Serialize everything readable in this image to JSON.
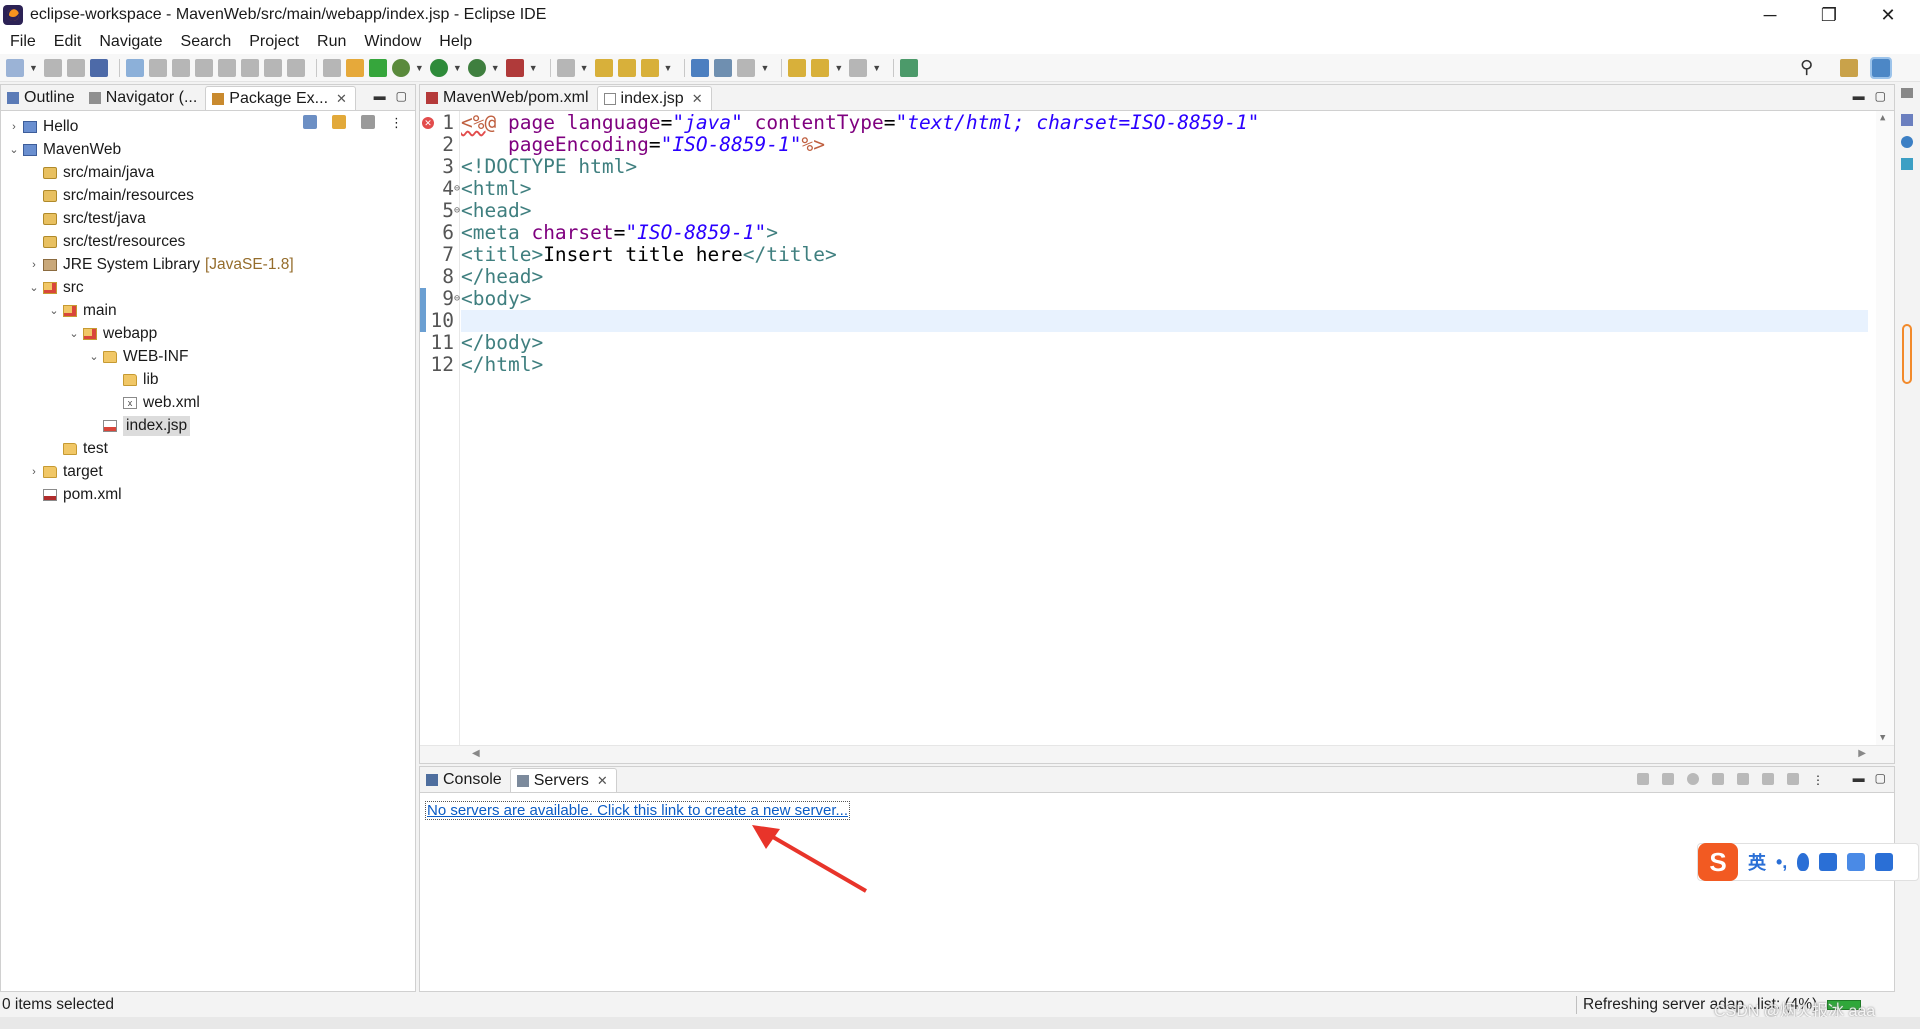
{
  "window": {
    "title": "eclipse-workspace - MavenWeb/src/main/webapp/index.jsp - Eclipse IDE",
    "minimize_glyph": "─",
    "maximize_glyph": "❐",
    "close_glyph": "✕"
  },
  "menu": [
    "File",
    "Edit",
    "Navigate",
    "Search",
    "Project",
    "Run",
    "Window",
    "Help"
  ],
  "toolbar": {
    "icons": [
      "new-icon",
      "save-icon",
      "save-all-icon",
      "terminal-icon",
      "skip-breakpoints-icon",
      "resume-icon",
      "suspend-icon",
      "terminate-icon",
      "disconnect-icon",
      "step-into-icon",
      "step-over-icon",
      "step-return-icon",
      "drop-to-frame-icon",
      "use-step-filters-icon",
      "spring-icon",
      "debug-icon",
      "run-icon",
      "coverage-icon",
      "external-tools-icon",
      "stop-server-icon",
      "open-type-icon",
      "open-task-icon",
      "search-toolbar-icon",
      "globe-icon",
      "annotation-icon",
      "next-annotation-icon",
      "last-edit-icon",
      "back-icon",
      "forward-icon",
      "pin-editor-icon"
    ],
    "search_glyph": "⚲"
  },
  "left_pane": {
    "tabs": [
      {
        "label": "Outline",
        "icon": "outline-icon"
      },
      {
        "label": "Navigator (...",
        "icon": "navigator-icon"
      },
      {
        "label": "Package Ex...",
        "icon": "package-explorer-icon",
        "active": true
      }
    ],
    "tree": [
      {
        "label": "Hello",
        "icon": "proj",
        "chev": "›",
        "depth": 0
      },
      {
        "label": "MavenWeb",
        "icon": "proj",
        "chev": "⌄",
        "depth": 0
      },
      {
        "label": "src/main/java",
        "icon": "pkg",
        "chev": "",
        "depth": 1
      },
      {
        "label": "src/main/resources",
        "icon": "pkg",
        "chev": "",
        "depth": 1
      },
      {
        "label": "src/test/java",
        "icon": "pkg",
        "chev": "",
        "depth": 1
      },
      {
        "label": "src/test/resources",
        "icon": "pkg",
        "chev": "",
        "depth": 1
      },
      {
        "label": "JRE System Library",
        "tag": "[JavaSE-1.8]",
        "icon": "lib",
        "chev": "›",
        "depth": 1
      },
      {
        "label": "src",
        "icon": "folder-web",
        "chev": "⌄",
        "depth": 1
      },
      {
        "label": "main",
        "icon": "folder-web",
        "chev": "⌄",
        "depth": 2
      },
      {
        "label": "webapp",
        "icon": "folder-web",
        "chev": "⌄",
        "depth": 3
      },
      {
        "label": "WEB-INF",
        "icon": "folder",
        "chev": "⌄",
        "depth": 4
      },
      {
        "label": "lib",
        "icon": "folder",
        "chev": "",
        "depth": 5
      },
      {
        "label": "web.xml",
        "icon": "xml",
        "chev": "",
        "depth": 5
      },
      {
        "label": "index.jsp",
        "icon": "jsp",
        "chev": "",
        "depth": 4,
        "selected": true
      },
      {
        "label": "test",
        "icon": "folder",
        "chev": "",
        "depth": 2
      },
      {
        "label": "target",
        "icon": "folder",
        "chev": "›",
        "depth": 1
      },
      {
        "label": "pom.xml",
        "icon": "pom",
        "chev": "",
        "depth": 1
      }
    ]
  },
  "editor": {
    "tabs": [
      {
        "label": "MavenWeb/pom.xml",
        "icon": "maven-file-icon"
      },
      {
        "label": "index.jsp",
        "icon": "jsp-file-icon",
        "active": true
      }
    ],
    "lines": [
      {
        "n": "1",
        "fold": "",
        "segments": [
          [
            "jsp",
            "<%@"
          ],
          [
            "t",
            " "
          ],
          [
            "attr",
            "page"
          ],
          [
            "t",
            " "
          ],
          [
            "attr",
            "language"
          ],
          [
            "t",
            "="
          ],
          [
            "str",
            "\"java\""
          ],
          [
            "t",
            " "
          ],
          [
            "attr",
            "contentType"
          ],
          [
            "t",
            "="
          ],
          [
            "str",
            "\"text/html; charset=ISO-8859-1\""
          ]
        ]
      },
      {
        "n": "2",
        "fold": "",
        "segments": [
          [
            "t",
            "    "
          ],
          [
            "attr",
            "pageEncoding"
          ],
          [
            "t",
            "="
          ],
          [
            "str",
            "\"ISO-8859-1\""
          ],
          [
            "jsp",
            "%>"
          ]
        ]
      },
      {
        "n": "3",
        "fold": "",
        "segments": [
          [
            "tag",
            "<!DOCTYPE html>"
          ]
        ]
      },
      {
        "n": "4",
        "fold": "⊖",
        "segments": [
          [
            "tag",
            "<html>"
          ]
        ]
      },
      {
        "n": "5",
        "fold": "⊖",
        "segments": [
          [
            "tag",
            "<head>"
          ]
        ]
      },
      {
        "n": "6",
        "fold": "",
        "segments": [
          [
            "tag",
            "<meta"
          ],
          [
            "t",
            " "
          ],
          [
            "attr",
            "charset"
          ],
          [
            "t",
            "="
          ],
          [
            "str",
            "\"ISO-8859-1\""
          ],
          [
            "tag",
            ">"
          ]
        ]
      },
      {
        "n": "7",
        "fold": "",
        "segments": [
          [
            "tag",
            "<title>"
          ],
          [
            "t",
            "Insert title here"
          ],
          [
            "tag",
            "</title>"
          ]
        ]
      },
      {
        "n": "8",
        "fold": "",
        "segments": [
          [
            "tag",
            "</head>"
          ]
        ]
      },
      {
        "n": "9",
        "fold": "⊖",
        "segments": [
          [
            "tag",
            "<body>"
          ]
        ]
      },
      {
        "n": "10",
        "fold": "",
        "segments": [],
        "current": true
      },
      {
        "n": "11",
        "fold": "",
        "segments": [
          [
            "tag",
            "</body>"
          ]
        ]
      },
      {
        "n": "12",
        "fold": "",
        "segments": [
          [
            "tag",
            "</html>"
          ]
        ]
      }
    ]
  },
  "bottom_pane": {
    "tabs": [
      {
        "label": "Console",
        "icon": "console-icon"
      },
      {
        "label": "Servers",
        "icon": "servers-icon",
        "active": true
      }
    ],
    "link_text": "No servers are available. Click this link to create a new server..."
  },
  "ime": {
    "logo": "S",
    "lang": "英",
    "punct": "•,"
  },
  "status": {
    "left": "0 items selected",
    "right": "Refreshing server adap...list: (4%)",
    "watermark": "CSDN @烟火报冰 aaa"
  },
  "colors": {
    "tag": "#3f7f7f",
    "attr": "#7f007f",
    "string": "#2a00ff",
    "jsp": "#bf5f3f",
    "current_line": "#e8f2fe",
    "link": "#0a5bc4",
    "arrow": "#e8342a"
  }
}
